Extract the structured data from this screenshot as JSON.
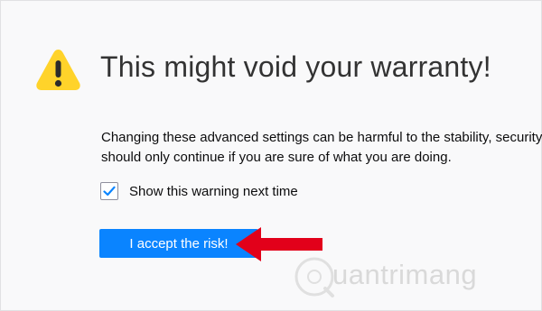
{
  "page": {
    "title": "This might void your warranty!",
    "description_line1": "Changing these advanced settings can be harmful to the stability, security, and performance of this application. You",
    "description_line2": "should only continue if you are sure of what you are doing."
  },
  "checkbox": {
    "label": "Show this warning next time",
    "checked": true
  },
  "button": {
    "label": "I accept the risk!"
  },
  "watermark": {
    "text": "uantrimang"
  },
  "colors": {
    "accent": "#0a84ff",
    "warning": "#ffd32a",
    "arrow": "#e2001a"
  },
  "icons": {
    "warning": "warning-icon",
    "check": "checkmark-icon",
    "arrow": "arrow-left-icon"
  }
}
